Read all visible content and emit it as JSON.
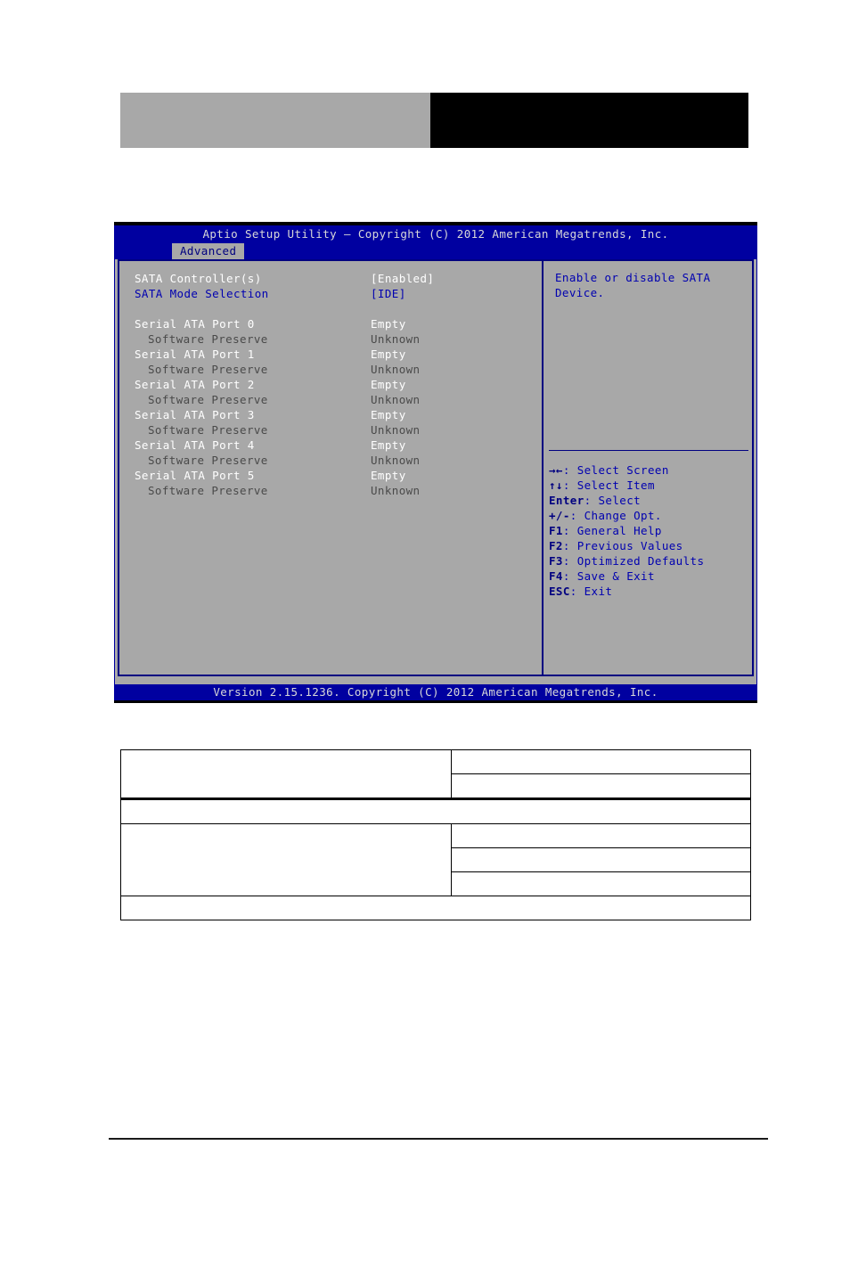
{
  "page": {
    "header_blocks": [
      {
        "name": "left-grey-block",
        "color": "#a8a8a8"
      },
      {
        "name": "right-black-block",
        "color": "#000000"
      }
    ]
  },
  "bios": {
    "title": "Aptio Setup Utility – Copyright (C) 2012 American Megatrends, Inc.",
    "active_tab": "Advanced",
    "tabs": [
      "Advanced"
    ],
    "colors": {
      "titlebar_bg": "#0000a0",
      "panel_bg": "#a8a8a8",
      "border": "#000080",
      "selected_text": "#0000b0",
      "normal_text": "#ffffff",
      "dim_text": "#4a4a4a"
    },
    "settings": [
      {
        "label": "SATA Controller(s)",
        "value": "[Enabled]",
        "indent": false,
        "selected": false
      },
      {
        "label": "SATA Mode Selection",
        "value": "[IDE]",
        "indent": false,
        "selected": true
      },
      {
        "label": "",
        "value": "",
        "spacer": true
      },
      {
        "label": "Serial ATA Port 0",
        "value": "Empty",
        "indent": false,
        "selected": false
      },
      {
        "label": "Software Preserve",
        "value": "Unknown",
        "indent": true,
        "selected": false
      },
      {
        "label": "Serial ATA Port 1",
        "value": "Empty",
        "indent": false,
        "selected": false
      },
      {
        "label": "Software Preserve",
        "value": "Unknown",
        "indent": true,
        "selected": false
      },
      {
        "label": "Serial ATA Port 2",
        "value": "Empty",
        "indent": false,
        "selected": false
      },
      {
        "label": "Software Preserve",
        "value": "Unknown",
        "indent": true,
        "selected": false
      },
      {
        "label": "Serial ATA Port 3",
        "value": "Empty",
        "indent": false,
        "selected": false
      },
      {
        "label": "Software Preserve",
        "value": "Unknown",
        "indent": true,
        "selected": false
      },
      {
        "label": "Serial ATA Port 4",
        "value": "Empty",
        "indent": false,
        "selected": false
      },
      {
        "label": "Software Preserve",
        "value": "Unknown",
        "indent": true,
        "selected": false
      },
      {
        "label": "Serial ATA Port 5",
        "value": "Empty",
        "indent": false,
        "selected": false
      },
      {
        "label": "Software Preserve",
        "value": "Unknown",
        "indent": true,
        "selected": false
      }
    ],
    "help": {
      "text": "Enable or disable SATA Device."
    },
    "nav_keys": [
      {
        "symbol": "→←",
        "label": ": Select Screen",
        "icon": "arrow-left-right-icon"
      },
      {
        "symbol": "↑↓",
        "label": ": Select Item",
        "icon": "arrow-up-down-icon"
      },
      {
        "symbol": "Enter",
        "label": ": Select",
        "icon": "enter-key-icon"
      },
      {
        "symbol": "+/-",
        "label": ": Change Opt.",
        "icon": "plus-minus-icon"
      },
      {
        "symbol": "F1",
        "label": ": General Help",
        "icon": "f1-key-icon"
      },
      {
        "symbol": "F2",
        "label": ": Previous Values",
        "icon": "f2-key-icon"
      },
      {
        "symbol": "F3",
        "label": ": Optimized Defaults",
        "icon": "f3-key-icon"
      },
      {
        "symbol": "F4",
        "label": ": Save & Exit",
        "icon": "f4-key-icon"
      },
      {
        "symbol": "ESC",
        "label": ": Exit",
        "icon": "esc-key-icon"
      }
    ],
    "footer": "Version 2.15.1236. Copyright (C) 2012 American Megatrends, Inc."
  },
  "spec_table": {
    "rows": [
      {
        "type": "split",
        "label": "",
        "value": ""
      },
      {
        "type": "value-only",
        "label": "",
        "value": ""
      },
      {
        "type": "full",
        "label": "",
        "value": ""
      },
      {
        "type": "split",
        "label": "",
        "value": ""
      },
      {
        "type": "value-only",
        "label": "",
        "value": ""
      },
      {
        "type": "value-only",
        "label": "",
        "value": ""
      },
      {
        "type": "full",
        "label": "",
        "value": ""
      }
    ]
  }
}
